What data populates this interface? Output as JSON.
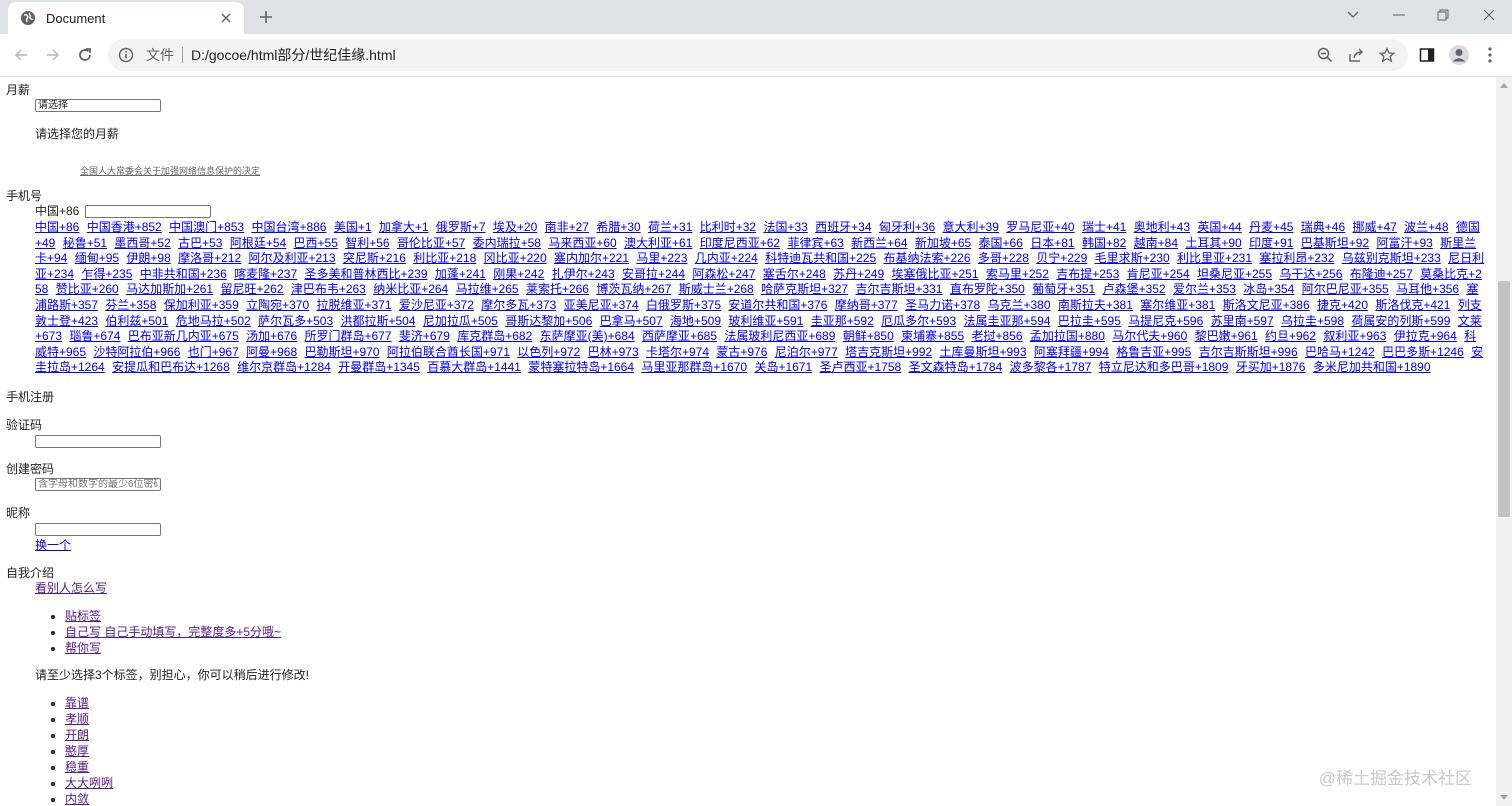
{
  "browser": {
    "tab_title": "Document",
    "secure_label": "文件",
    "url": "D:/gocoe/html部分/世纪佳缘.html"
  },
  "page": {
    "salary": {
      "label": "月薪",
      "select_value": "请选择",
      "hint": "请选择您的月薪",
      "law_link": "全国人大常委会关于加强网络信息保护的决定"
    },
    "phone": {
      "label": "手机号",
      "prefix": "中国+86",
      "codes": [
        "中国+86",
        "中国香港+852",
        "中国澳门+853",
        "中国台湾+886",
        "美国+1",
        "加拿大+1",
        "俄罗斯+7",
        "埃及+20",
        "南非+27",
        "希腊+30",
        "荷兰+31",
        "比利时+32",
        "法国+33",
        "西班牙+34",
        "匈牙利+36",
        "意大利+39",
        "罗马尼亚+40",
        "瑞士+41",
        "奥地利+43",
        "英国+44",
        "丹麦+45",
        "瑞典+46",
        "挪威+47",
        "波兰+48",
        "德国+49",
        "秘鲁+51",
        "墨西哥+52",
        "古巴+53",
        "阿根廷+54",
        "巴西+55",
        "智利+56",
        "哥伦比亚+57",
        "委内瑞拉+58",
        "马来西亚+60",
        "澳大利亚+61",
        "印度尼西亚+62",
        "菲律宾+63",
        "新西兰+64",
        "新加坡+65",
        "泰国+66",
        "日本+81",
        "韩国+82",
        "越南+84",
        "土耳其+90",
        "印度+91",
        "巴基斯坦+92",
        "阿富汗+93",
        "斯里兰卡+94",
        "缅甸+95",
        "伊朗+98",
        "摩洛哥+212",
        "阿尔及利亚+213",
        "突尼斯+216",
        "利比亚+218",
        "冈比亚+220",
        "塞内加尔+221",
        "马里+223",
        "几内亚+224",
        "科特迪瓦共和国+225",
        "布基纳法索+226",
        "多哥+228",
        "贝宁+229",
        "毛里求斯+230",
        "利比里亚+231",
        "塞拉利昂+232",
        "乌兹别克斯坦+233",
        "尼日利亚+234",
        "乍得+235",
        "中非共和国+236",
        "喀麦隆+237",
        "圣多美和普林西比+239",
        "加蓬+241",
        "刚果+242",
        "扎伊尔+243",
        "安哥拉+244",
        "阿森松+247",
        "塞舌尔+248",
        "苏丹+249",
        "埃塞俄比亚+251",
        "索马里+252",
        "吉布提+253",
        "肯尼亚+254",
        "坦桑尼亚+255",
        "乌干达+256",
        "布隆迪+257",
        "莫桑比克+258",
        "赞比亚+260",
        "马达加斯加+261",
        "留尼旺+262",
        "津巴布韦+263",
        "纳米比亚+264",
        "马拉维+265",
        "莱索托+266",
        "博茨瓦纳+267",
        "斯威士兰+268",
        "哈萨克斯坦+327",
        "吉尔吉斯坦+331",
        "直布罗陀+350",
        "葡萄牙+351",
        "卢森堡+352",
        "爱尔兰+353",
        "冰岛+354",
        "阿尔巴尼亚+355",
        "马耳他+356",
        "塞浦路斯+357",
        "芬兰+358",
        "保加利亚+359",
        "立陶宛+370",
        "拉脱维亚+371",
        "爱沙尼亚+372",
        "摩尔多瓦+373",
        "亚美尼亚+374",
        "白俄罗斯+375",
        "安道尔共和国+376",
        "摩纳哥+377",
        "圣马力诺+378",
        "乌克兰+380",
        "南斯拉夫+381",
        "塞尔维亚+381",
        "斯洛文尼亚+386",
        "捷克+420",
        "斯洛伐克+421",
        "列支敦士登+423",
        "伯利兹+501",
        "危地马拉+502",
        "萨尔瓦多+503",
        "洪都拉斯+504",
        "尼加拉瓜+505",
        "哥斯达黎加+506",
        "巴拿马+507",
        "海地+509",
        "玻利维亚+591",
        "圭亚那+592",
        "厄瓜多尔+593",
        "法属圭亚那+594",
        "巴拉圭+595",
        "马提尼克+596",
        "苏里南+597",
        "乌拉圭+598",
        "荷属安的列斯+599",
        "文莱+673",
        "瑙鲁+674",
        "巴布亚新几内亚+675",
        "汤加+676",
        "所罗门群岛+677",
        "斐济+679",
        "库克群岛+682",
        "东萨摩亚(美)+684",
        "西萨摩亚+685",
        "法属玻利尼西亚+689",
        "朝鲜+850",
        "柬埔寨+855",
        "老挝+856",
        "孟加拉国+880",
        "马尔代夫+960",
        "黎巴嫩+961",
        "约旦+962",
        "叙利亚+963",
        "伊拉克+964",
        "科威特+965",
        "沙特阿拉伯+966",
        "也门+967",
        "阿曼+968",
        "巴勒斯坦+970",
        "阿拉伯联合酋长国+971",
        "以色列+972",
        "巴林+973",
        "卡塔尔+974",
        "蒙古+976",
        "尼泊尔+977",
        "塔吉克斯坦+992",
        "土库曼斯坦+993",
        "阿塞拜疆+994",
        "格鲁吉亚+995",
        "吉尔吉斯斯坦+996",
        "巴哈马+1242",
        "巴巴多斯+1246",
        "安圭拉岛+1264",
        "安提瓜和巴布达+1268",
        "维尔京群岛+1284",
        "开曼群岛+1345",
        "百慕大群岛+1441",
        "蒙特塞拉特岛+1664",
        "马里亚那群岛+1670",
        "关岛+1671",
        "圣卢西亚+1758",
        "圣文森特岛+1784",
        "波多黎各+1787",
        "特立尼达和多巴哥+1809",
        "牙买加+1876",
        "多米尼加共和国+1890"
      ]
    },
    "register": {
      "label": "手机注册"
    },
    "captcha": {
      "label": "验证码"
    },
    "password": {
      "label": "创建密码",
      "placeholder": "含字母和数字的最少6位密码"
    },
    "nickname": {
      "label": "昵称",
      "change_link": "换一个"
    },
    "intro": {
      "label": "自我介绍",
      "see_others": "看别人怎么写",
      "options": [
        "贴标签",
        "自己写 自己手动填写，完整度多+5分哦~",
        "帮你写"
      ],
      "tip": "请至少选择3个标签，别担心，你可以稍后进行修改!",
      "tags": [
        "靠谱",
        "孝顺",
        "开朗",
        "憨厚",
        "稳重",
        "大大咧咧",
        "内敛"
      ]
    },
    "watermark": "@稀土掘金技术社区"
  }
}
